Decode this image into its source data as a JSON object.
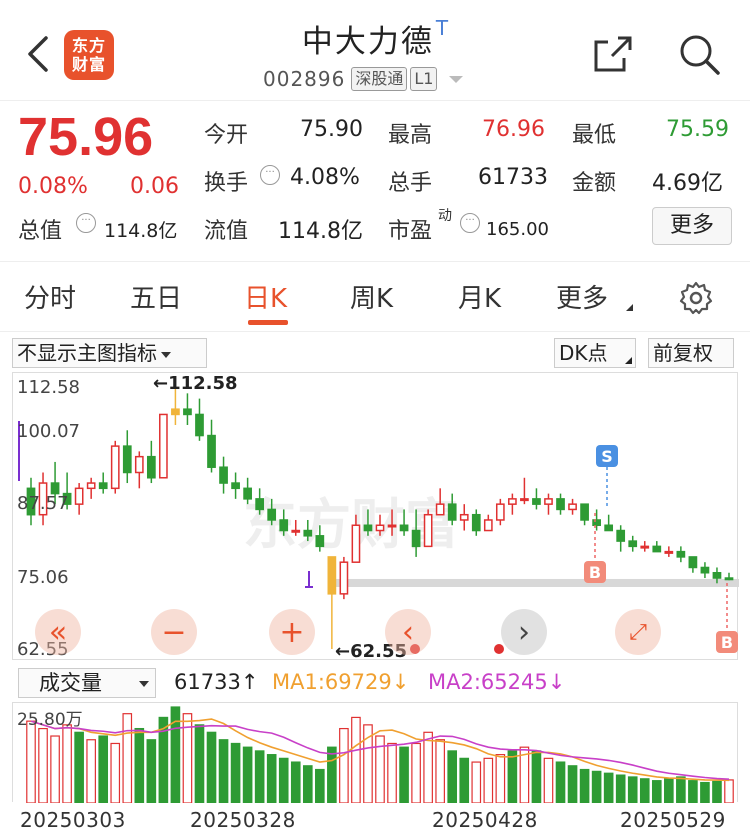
{
  "header": {
    "logo_line1": "东方",
    "logo_line2": "财富",
    "stock_name": "中大力德",
    "stock_name_tag": "T",
    "code": "002896",
    "tag1": "深股通",
    "tag2": "L1"
  },
  "quote": {
    "price": "75.96",
    "change_pct": "0.08%",
    "change_abs": "0.06",
    "open_label": "今开",
    "open_value": "75.90",
    "high_label": "最高",
    "high_value": "76.96",
    "low_label": "最低",
    "low_value": "75.59",
    "turnover_label": "换手",
    "turnover_value": "4.08%",
    "volume_label": "总手",
    "volume_value": "61733",
    "amount_label": "金额",
    "amount_value": "4.69亿",
    "mktcap_label": "总值",
    "mktcap_value": "114.8亿",
    "float_label": "流值",
    "float_value": "114.8亿",
    "pe_label": "市盈",
    "pe_sup": "动",
    "pe_value": "165.00",
    "more_button": "更多"
  },
  "tabs": {
    "items": [
      "分时",
      "五日",
      "日K",
      "周K",
      "月K",
      "更多"
    ],
    "active": "日K"
  },
  "chart_toolbar": {
    "indicator_select": "不显示主图指标",
    "dk_button": "DK点",
    "adjust_button": "前复权"
  },
  "main_chart": {
    "y_labels": [
      "112.58",
      "100.07",
      "87.57",
      "75.06",
      "62.55"
    ],
    "high_marker": "←112.58",
    "low_marker": "←62.55",
    "watermark": "东方财富",
    "signal_s": "S",
    "signal_b": "B",
    "colors": {
      "up": "#e03131",
      "down": "#2e9b34",
      "purple": "#7a2fd0",
      "yellow": "#f0b43a",
      "blue": "#4a90e2"
    }
  },
  "volume": {
    "select_label": "成交量",
    "vol_value": "61733",
    "vol_arrow": "↑",
    "ma1": "MA1:69729",
    "ma1_arrow": "↓",
    "ma2": "MA2:65245",
    "ma2_arrow": "↓",
    "max_label": "25.80万",
    "colors": {
      "ma1": "#f0a030",
      "ma2": "#c840c8"
    }
  },
  "dates": [
    "20250303",
    "20250328",
    "20250428",
    "20250529"
  ],
  "chart_data": {
    "type": "candlestick",
    "ylim": [
      62.55,
      112.58
    ],
    "candles": [
      [
        93,
        95,
        86,
        88
      ],
      [
        88,
        96,
        86,
        94
      ],
      [
        94,
        98,
        90,
        92
      ],
      [
        92,
        96,
        89,
        90
      ],
      [
        90,
        94,
        88,
        93
      ],
      [
        93,
        95,
        91,
        94
      ],
      [
        94,
        96,
        92,
        93
      ],
      [
        93,
        102,
        92,
        101
      ],
      [
        101,
        104,
        94,
        96
      ],
      [
        96,
        100,
        93,
        99
      ],
      [
        99,
        102,
        94,
        95
      ],
      [
        95,
        107,
        95,
        107
      ],
      [
        107,
        112.58,
        105,
        108
      ],
      [
        108,
        111,
        105,
        107
      ],
      [
        107,
        110,
        102,
        103
      ],
      [
        103,
        106,
        96,
        97
      ],
      [
        97,
        99,
        92,
        94
      ],
      [
        94,
        96,
        91,
        93
      ],
      [
        93,
        95,
        90,
        91
      ],
      [
        91,
        93,
        88,
        89
      ],
      [
        89,
        91,
        86,
        87
      ],
      [
        87,
        89,
        84,
        85
      ],
      [
        85,
        87,
        84,
        85
      ],
      [
        85,
        87,
        83,
        84
      ],
      [
        84,
        86,
        81,
        82
      ],
      [
        80,
        76,
        62.55,
        73
      ],
      [
        73,
        80,
        72,
        79
      ],
      [
        79,
        88,
        79,
        86
      ],
      [
        86,
        89,
        84,
        85
      ],
      [
        85,
        88,
        84,
        86
      ],
      [
        86,
        89,
        84,
        86
      ],
      [
        86,
        89,
        84,
        85
      ],
      [
        85,
        89,
        80,
        82
      ],
      [
        82,
        89,
        82,
        88
      ],
      [
        88,
        93,
        88,
        90
      ],
      [
        90,
        92,
        86,
        87
      ],
      [
        87,
        90,
        85,
        88
      ],
      [
        88,
        89,
        84,
        85
      ],
      [
        85,
        88,
        85,
        87
      ],
      [
        87,
        91,
        86,
        90
      ],
      [
        90,
        92,
        88,
        91
      ],
      [
        91,
        95,
        90,
        91
      ],
      [
        91,
        93,
        89,
        90
      ],
      [
        90,
        92,
        88,
        91
      ],
      [
        91,
        92,
        88,
        89
      ],
      [
        89,
        91,
        88,
        90
      ],
      [
        90,
        90,
        86,
        87
      ],
      [
        87,
        89,
        85,
        86
      ],
      [
        86,
        88,
        85,
        85
      ],
      [
        85,
        86,
        81,
        83
      ],
      [
        83,
        84,
        81,
        82
      ],
      [
        82,
        83,
        81,
        82
      ],
      [
        82,
        83,
        81,
        81
      ],
      [
        81,
        82,
        80,
        81
      ],
      [
        81,
        82,
        79,
        80
      ],
      [
        80,
        80,
        77,
        78
      ],
      [
        78,
        79,
        76,
        77
      ],
      [
        77,
        78,
        75,
        76
      ],
      [
        76,
        77,
        75.59,
        75.96
      ]
    ],
    "volume_ylim": [
      0,
      258000
    ],
    "volumes": [
      [
        220,
        1
      ],
      [
        200,
        1
      ],
      [
        180,
        1
      ],
      [
        210,
        1
      ],
      [
        190,
        0
      ],
      [
        170,
        1
      ],
      [
        180,
        0
      ],
      [
        160,
        1
      ],
      [
        240,
        1
      ],
      [
        200,
        0
      ],
      [
        170,
        0
      ],
      [
        230,
        0
      ],
      [
        258,
        0
      ],
      [
        240,
        1
      ],
      [
        210,
        0
      ],
      [
        190,
        0
      ],
      [
        170,
        0
      ],
      [
        160,
        0
      ],
      [
        150,
        0
      ],
      [
        140,
        0
      ],
      [
        130,
        0
      ],
      [
        120,
        0
      ],
      [
        110,
        0
      ],
      [
        100,
        0
      ],
      [
        90,
        0
      ],
      [
        150,
        0
      ],
      [
        200,
        1
      ],
      [
        230,
        1
      ],
      [
        210,
        1
      ],
      [
        180,
        1
      ],
      [
        160,
        1
      ],
      [
        150,
        0
      ],
      [
        160,
        1
      ],
      [
        190,
        1
      ],
      [
        170,
        1
      ],
      [
        140,
        0
      ],
      [
        120,
        0
      ],
      [
        110,
        1
      ],
      [
        120,
        1
      ],
      [
        130,
        1
      ],
      [
        140,
        0
      ],
      [
        150,
        1
      ],
      [
        140,
        0
      ],
      [
        120,
        1
      ],
      [
        110,
        0
      ],
      [
        100,
        0
      ],
      [
        90,
        0
      ],
      [
        85,
        0
      ],
      [
        80,
        0
      ],
      [
        75,
        0
      ],
      [
        70,
        0
      ],
      [
        65,
        0
      ],
      [
        60,
        0
      ],
      [
        65,
        0
      ],
      [
        70,
        0
      ],
      [
        60,
        0
      ],
      [
        55,
        0
      ],
      [
        58,
        0
      ],
      [
        62,
        1
      ]
    ]
  }
}
